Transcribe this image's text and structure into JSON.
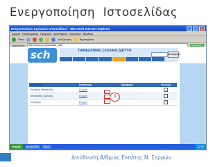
{
  "slide": {
    "title": "Ενεργοποίηση  Ιστοσελίδας",
    "footer": "Διεύθυνση Α/θμιας Εκπ/σης Ν. Σερρών"
  },
  "window": {
    "title": "Ενεργοποίηση Σχολικών Ιστοσελίδων - Microsoft Internet Explorer",
    "menu": [
      "Αρχείο",
      "Επεξεργασία",
      "Προβολή",
      "Αγαπημένα",
      "Εργαλεία",
      "Βοήθεια"
    ],
    "toolbar": [
      "Πίσω",
      "Αναζήτηση",
      "Αγαπημένα"
    ],
    "address_label": "Διεύθυνση",
    "address": "http://www.sch.gr/activate_web",
    "go_label": "Μετάβαση"
  },
  "page": {
    "logo": "sch",
    "banner_title": "ΠΑΝΕΛΛΗΝΙΟ ΣΧΟΛΙΚΟ ΔΙΚΤΥΟ",
    "search_button": "Αναζήτηση",
    "table": {
      "headers": [
        "Ονομασία",
        "Κατάσταση",
        "Πρόσβαση",
        "Επιλογή"
      ],
      "rows": [
        {
          "name": "Κεντρική Ιστοσελίδα",
          "status": "Ενεργή",
          "access": ""
        },
        {
          "name": "Ιστοσελίδα Σχολείου",
          "status": "Ενεργή",
          "access": ""
        },
        {
          "name": "Ιστολόγιο",
          "status": "Ενεργή",
          "access": ""
        }
      ]
    },
    "step_marker": "3"
  },
  "taskbar": {
    "start": "έναρξη",
    "tasks": [
      "Ιστοσελίδα",
      "Word"
    ],
    "clock": "12:00"
  }
}
